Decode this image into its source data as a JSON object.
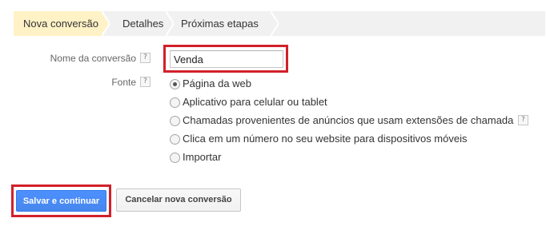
{
  "steps": [
    {
      "label": "Nova conversão",
      "active": true
    },
    {
      "label": "Detalhes",
      "active": false
    },
    {
      "label": "Próximas etapas",
      "active": false
    }
  ],
  "form": {
    "name_label": "Nome da conversão",
    "name_value": "Venda",
    "help_glyph": "?",
    "source_label": "Fonte",
    "source_options": [
      {
        "label": "Página da web",
        "checked": true
      },
      {
        "label": "Aplicativo para celular ou tablet",
        "checked": false
      },
      {
        "label": "Chamadas provenientes de anúncios que usam extensões de chamada",
        "checked": false,
        "help": true
      },
      {
        "label": "Clica em um número no seu website para dispositivos móveis",
        "checked": false
      },
      {
        "label": "Importar",
        "checked": false
      }
    ]
  },
  "buttons": {
    "save_label": "Salvar e continuar",
    "cancel_label": "Cancelar nova conversão"
  },
  "colors": {
    "highlight_border": "#d2202a",
    "active_step_bg": "#fff2c6",
    "step_bar_bg": "#f1f1f1",
    "primary_button": "#4d90fe"
  }
}
